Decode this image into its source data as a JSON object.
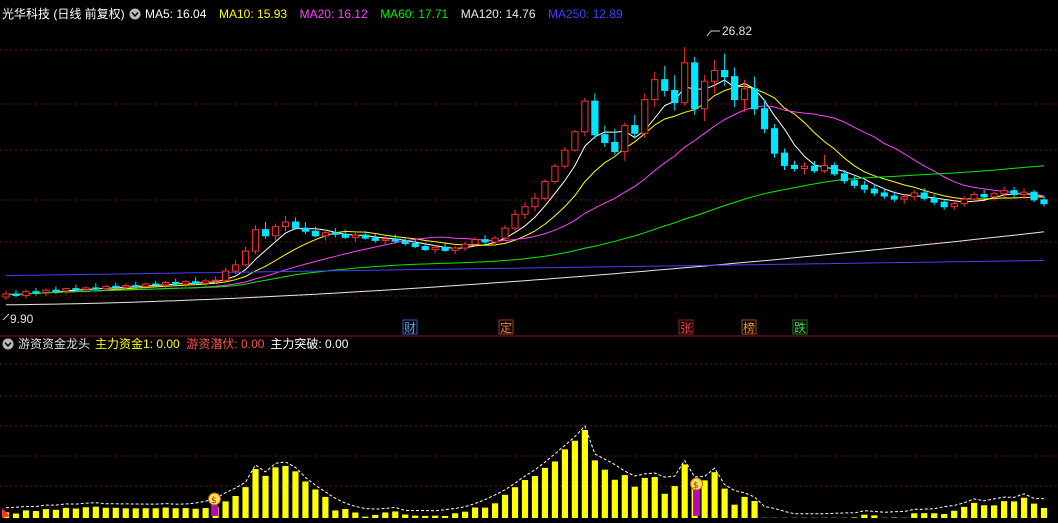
{
  "header": {
    "stock": "光华科技 (日线 前复权)",
    "ma": [
      {
        "label": "MA5: 16.04",
        "color": "#ffffff"
      },
      {
        "label": "MA10: 15.93",
        "color": "#ffff00"
      },
      {
        "label": "MA20: 16.12",
        "color": "#ff40ff"
      },
      {
        "label": "MA60: 17.71",
        "color": "#00ee00"
      },
      {
        "label": "MA120: 14.76",
        "color": "#e8e8e8"
      },
      {
        "label": "MA250: 12.89",
        "color": "#4040ff"
      }
    ]
  },
  "price_labels": {
    "high": "26.82",
    "low": "9.90"
  },
  "events": [
    {
      "text": "财",
      "color": "#5aa0ff",
      "border": "#3060c0"
    },
    {
      "text": "定",
      "color": "#ff8040",
      "border": "#a04020"
    },
    {
      "text": "张",
      "color": "#ff4040",
      "border": "#a02020"
    },
    {
      "text": "榜",
      "color": "#ff9030",
      "border": "#a05020"
    },
    {
      "text": "跌",
      "color": "#40e040",
      "border": "#208020"
    }
  ],
  "indicator": {
    "name": "游资资金龙头",
    "items": [
      {
        "label": "主力资金1: 0.00",
        "color": "#ffff00"
      },
      {
        "label": "游资潜伏: 0.00",
        "color": "#ff5050"
      },
      {
        "label": "主力突破: 0.00",
        "color": "#ffffff"
      }
    ]
  },
  "colors": {
    "up": "#ff3030",
    "down": "#00e5ff",
    "volume": "#ffff00",
    "grid": "#6a1414"
  },
  "chart_data": {
    "type": "candlestick",
    "ylim": [
      9.0,
      28.6
    ],
    "candles": [
      [
        10.5,
        10.9,
        10.3,
        10.7
      ],
      [
        10.7,
        10.95,
        10.5,
        10.6
      ],
      [
        10.6,
        11.0,
        10.4,
        10.85
      ],
      [
        10.85,
        11.1,
        10.6,
        10.8
      ],
      [
        10.8,
        11.05,
        10.6,
        10.95
      ],
      [
        10.95,
        11.2,
        10.7,
        10.9
      ],
      [
        10.9,
        11.1,
        10.7,
        11.05
      ],
      [
        11.05,
        11.3,
        10.9,
        11.0
      ],
      [
        11.0,
        11.2,
        10.8,
        11.1
      ],
      [
        11.1,
        11.4,
        10.95,
        11.05
      ],
      [
        11.05,
        11.3,
        10.9,
        11.2
      ],
      [
        11.2,
        11.45,
        11.0,
        11.15
      ],
      [
        11.15,
        11.4,
        11.0,
        11.25
      ],
      [
        11.25,
        11.5,
        11.05,
        11.2
      ],
      [
        11.2,
        11.45,
        11.05,
        11.35
      ],
      [
        11.35,
        11.55,
        11.15,
        11.3
      ],
      [
        11.3,
        11.55,
        11.1,
        11.45
      ],
      [
        11.45,
        11.7,
        11.25,
        11.35
      ],
      [
        11.35,
        11.6,
        11.15,
        11.5
      ],
      [
        11.5,
        11.8,
        11.3,
        11.4
      ],
      [
        11.4,
        11.7,
        11.2,
        11.55
      ],
      [
        11.55,
        11.85,
        11.35,
        11.6
      ],
      [
        11.6,
        12.4,
        11.5,
        12.2
      ],
      [
        12.2,
        12.9,
        12.0,
        12.6
      ],
      [
        12.6,
        13.8,
        12.5,
        13.5
      ],
      [
        13.5,
        15.2,
        13.3,
        14.9
      ],
      [
        14.9,
        15.4,
        14.3,
        14.5
      ],
      [
        14.5,
        15.3,
        14.2,
        15.1
      ],
      [
        15.1,
        15.8,
        14.8,
        15.4
      ],
      [
        15.4,
        15.7,
        14.9,
        15.0
      ],
      [
        15.0,
        15.4,
        14.6,
        14.8
      ],
      [
        14.8,
        15.1,
        14.4,
        14.5
      ],
      [
        14.5,
        14.9,
        14.2,
        14.7
      ],
      [
        14.7,
        15.0,
        14.4,
        14.6
      ],
      [
        14.6,
        14.9,
        14.3,
        14.4
      ],
      [
        14.4,
        14.7,
        14.1,
        14.55
      ],
      [
        14.55,
        14.8,
        14.25,
        14.35
      ],
      [
        14.35,
        14.6,
        14.05,
        14.2
      ],
      [
        14.2,
        14.5,
        13.95,
        14.3
      ],
      [
        14.3,
        14.6,
        14.0,
        14.15
      ],
      [
        14.15,
        14.4,
        13.85,
        14.0
      ],
      [
        14.0,
        14.3,
        13.7,
        13.8
      ],
      [
        13.8,
        14.05,
        13.5,
        13.6
      ],
      [
        13.6,
        13.9,
        13.35,
        13.75
      ],
      [
        13.75,
        14.0,
        13.45,
        13.55
      ],
      [
        13.55,
        13.85,
        13.3,
        13.7
      ],
      [
        13.7,
        14.1,
        13.5,
        13.95
      ],
      [
        13.95,
        14.4,
        13.8,
        14.25
      ],
      [
        14.25,
        14.55,
        13.95,
        14.1
      ],
      [
        14.1,
        14.5,
        13.9,
        14.35
      ],
      [
        14.35,
        15.2,
        14.2,
        15.0
      ],
      [
        15.0,
        16.2,
        14.8,
        15.9
      ],
      [
        15.9,
        16.7,
        15.6,
        16.4
      ],
      [
        16.4,
        17.3,
        16.1,
        16.95
      ],
      [
        16.95,
        18.2,
        16.8,
        18.05
      ],
      [
        18.05,
        19.2,
        17.9,
        19.05
      ],
      [
        19.05,
        20.3,
        18.9,
        20.1
      ],
      [
        20.1,
        21.4,
        20.0,
        21.3
      ],
      [
        21.3,
        23.5,
        21.0,
        23.3
      ],
      [
        23.3,
        23.8,
        20.8,
        21.1
      ],
      [
        21.1,
        21.7,
        20.3,
        20.6
      ],
      [
        20.6,
        21.5,
        19.8,
        20.0
      ],
      [
        20.0,
        21.9,
        19.4,
        21.7
      ],
      [
        21.7,
        22.4,
        20.9,
        21.2
      ],
      [
        21.2,
        23.8,
        20.9,
        23.4
      ],
      [
        23.4,
        25.2,
        22.9,
        24.7
      ],
      [
        24.7,
        25.6,
        23.6,
        24.0
      ],
      [
        24.0,
        25.0,
        22.7,
        23.2
      ],
      [
        23.2,
        26.82,
        23.0,
        25.8
      ],
      [
        25.8,
        26.2,
        22.4,
        22.8
      ],
      [
        22.8,
        25.0,
        22.0,
        24.6
      ],
      [
        24.6,
        26.0,
        23.8,
        25.3
      ],
      [
        25.3,
        26.4,
        24.3,
        24.9
      ],
      [
        24.9,
        25.5,
        22.9,
        23.4
      ],
      [
        23.4,
        24.7,
        22.6,
        24.1
      ],
      [
        24.1,
        24.9,
        22.4,
        22.8
      ],
      [
        22.8,
        23.4,
        21.2,
        21.5
      ],
      [
        21.5,
        21.8,
        19.6,
        19.9
      ],
      [
        19.9,
        20.2,
        18.8,
        19.1
      ],
      [
        19.1,
        19.4,
        18.7,
        18.9
      ],
      [
        18.9,
        19.3,
        18.5,
        19.05
      ],
      [
        19.05,
        19.4,
        18.6,
        18.75
      ],
      [
        18.75,
        19.8,
        18.6,
        19.1
      ],
      [
        19.1,
        19.3,
        18.4,
        18.55
      ],
      [
        18.55,
        18.8,
        17.9,
        18.1
      ],
      [
        18.1,
        18.4,
        17.6,
        17.8
      ],
      [
        17.8,
        18.1,
        17.3,
        17.55
      ],
      [
        17.55,
        17.9,
        17.1,
        17.3
      ],
      [
        17.3,
        17.6,
        16.9,
        17.1
      ],
      [
        17.1,
        17.4,
        16.7,
        16.9
      ],
      [
        16.9,
        17.2,
        16.6,
        17.05
      ],
      [
        17.05,
        17.5,
        16.8,
        17.3
      ],
      [
        17.3,
        17.6,
        16.8,
        16.95
      ],
      [
        16.95,
        17.2,
        16.5,
        16.7
      ],
      [
        16.7,
        16.9,
        16.2,
        16.4
      ],
      [
        16.4,
        16.8,
        16.2,
        16.6
      ],
      [
        16.6,
        17.1,
        16.4,
        16.9
      ],
      [
        16.9,
        17.4,
        16.7,
        17.2
      ],
      [
        17.2,
        17.5,
        16.9,
        17.05
      ],
      [
        17.05,
        17.4,
        16.8,
        17.25
      ],
      [
        17.25,
        17.7,
        17.0,
        17.45
      ],
      [
        17.45,
        17.7,
        17.0,
        17.2
      ],
      [
        17.2,
        17.6,
        16.9,
        17.35
      ],
      [
        17.35,
        17.5,
        16.7,
        16.85
      ],
      [
        16.85,
        17.1,
        16.4,
        16.6
      ]
    ]
  }
}
